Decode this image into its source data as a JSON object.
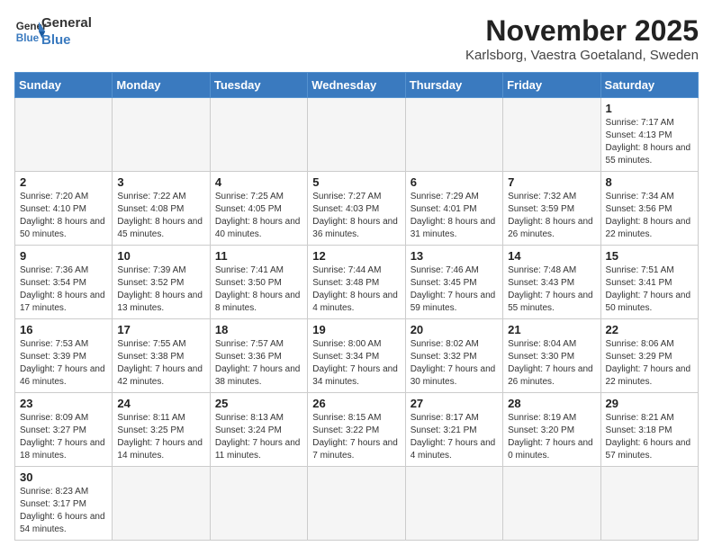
{
  "header": {
    "logo_line1": "General",
    "logo_line2": "Blue",
    "month": "November 2025",
    "location": "Karlsborg, Vaestra Goetaland, Sweden"
  },
  "days_of_week": [
    "Sunday",
    "Monday",
    "Tuesday",
    "Wednesday",
    "Thursday",
    "Friday",
    "Saturday"
  ],
  "weeks": [
    [
      {
        "day": "",
        "info": ""
      },
      {
        "day": "",
        "info": ""
      },
      {
        "day": "",
        "info": ""
      },
      {
        "day": "",
        "info": ""
      },
      {
        "day": "",
        "info": ""
      },
      {
        "day": "",
        "info": ""
      },
      {
        "day": "1",
        "info": "Sunrise: 7:17 AM\nSunset: 4:13 PM\nDaylight: 8 hours\nand 55 minutes."
      }
    ],
    [
      {
        "day": "2",
        "info": "Sunrise: 7:20 AM\nSunset: 4:10 PM\nDaylight: 8 hours\nand 50 minutes."
      },
      {
        "day": "3",
        "info": "Sunrise: 7:22 AM\nSunset: 4:08 PM\nDaylight: 8 hours\nand 45 minutes."
      },
      {
        "day": "4",
        "info": "Sunrise: 7:25 AM\nSunset: 4:05 PM\nDaylight: 8 hours\nand 40 minutes."
      },
      {
        "day": "5",
        "info": "Sunrise: 7:27 AM\nSunset: 4:03 PM\nDaylight: 8 hours\nand 36 minutes."
      },
      {
        "day": "6",
        "info": "Sunrise: 7:29 AM\nSunset: 4:01 PM\nDaylight: 8 hours\nand 31 minutes."
      },
      {
        "day": "7",
        "info": "Sunrise: 7:32 AM\nSunset: 3:59 PM\nDaylight: 8 hours\nand 26 minutes."
      },
      {
        "day": "8",
        "info": "Sunrise: 7:34 AM\nSunset: 3:56 PM\nDaylight: 8 hours\nand 22 minutes."
      }
    ],
    [
      {
        "day": "9",
        "info": "Sunrise: 7:36 AM\nSunset: 3:54 PM\nDaylight: 8 hours\nand 17 minutes."
      },
      {
        "day": "10",
        "info": "Sunrise: 7:39 AM\nSunset: 3:52 PM\nDaylight: 8 hours\nand 13 minutes."
      },
      {
        "day": "11",
        "info": "Sunrise: 7:41 AM\nSunset: 3:50 PM\nDaylight: 8 hours\nand 8 minutes."
      },
      {
        "day": "12",
        "info": "Sunrise: 7:44 AM\nSunset: 3:48 PM\nDaylight: 8 hours\nand 4 minutes."
      },
      {
        "day": "13",
        "info": "Sunrise: 7:46 AM\nSunset: 3:45 PM\nDaylight: 7 hours\nand 59 minutes."
      },
      {
        "day": "14",
        "info": "Sunrise: 7:48 AM\nSunset: 3:43 PM\nDaylight: 7 hours\nand 55 minutes."
      },
      {
        "day": "15",
        "info": "Sunrise: 7:51 AM\nSunset: 3:41 PM\nDaylight: 7 hours\nand 50 minutes."
      }
    ],
    [
      {
        "day": "16",
        "info": "Sunrise: 7:53 AM\nSunset: 3:39 PM\nDaylight: 7 hours\nand 46 minutes."
      },
      {
        "day": "17",
        "info": "Sunrise: 7:55 AM\nSunset: 3:38 PM\nDaylight: 7 hours\nand 42 minutes."
      },
      {
        "day": "18",
        "info": "Sunrise: 7:57 AM\nSunset: 3:36 PM\nDaylight: 7 hours\nand 38 minutes."
      },
      {
        "day": "19",
        "info": "Sunrise: 8:00 AM\nSunset: 3:34 PM\nDaylight: 7 hours\nand 34 minutes."
      },
      {
        "day": "20",
        "info": "Sunrise: 8:02 AM\nSunset: 3:32 PM\nDaylight: 7 hours\nand 30 minutes."
      },
      {
        "day": "21",
        "info": "Sunrise: 8:04 AM\nSunset: 3:30 PM\nDaylight: 7 hours\nand 26 minutes."
      },
      {
        "day": "22",
        "info": "Sunrise: 8:06 AM\nSunset: 3:29 PM\nDaylight: 7 hours\nand 22 minutes."
      }
    ],
    [
      {
        "day": "23",
        "info": "Sunrise: 8:09 AM\nSunset: 3:27 PM\nDaylight: 7 hours\nand 18 minutes."
      },
      {
        "day": "24",
        "info": "Sunrise: 8:11 AM\nSunset: 3:25 PM\nDaylight: 7 hours\nand 14 minutes."
      },
      {
        "day": "25",
        "info": "Sunrise: 8:13 AM\nSunset: 3:24 PM\nDaylight: 7 hours\nand 11 minutes."
      },
      {
        "day": "26",
        "info": "Sunrise: 8:15 AM\nSunset: 3:22 PM\nDaylight: 7 hours\nand 7 minutes."
      },
      {
        "day": "27",
        "info": "Sunrise: 8:17 AM\nSunset: 3:21 PM\nDaylight: 7 hours\nand 4 minutes."
      },
      {
        "day": "28",
        "info": "Sunrise: 8:19 AM\nSunset: 3:20 PM\nDaylight: 7 hours\nand 0 minutes."
      },
      {
        "day": "29",
        "info": "Sunrise: 8:21 AM\nSunset: 3:18 PM\nDaylight: 6 hours\nand 57 minutes."
      }
    ],
    [
      {
        "day": "30",
        "info": "Sunrise: 8:23 AM\nSunset: 3:17 PM\nDaylight: 6 hours\nand 54 minutes."
      },
      {
        "day": "",
        "info": ""
      },
      {
        "day": "",
        "info": ""
      },
      {
        "day": "",
        "info": ""
      },
      {
        "day": "",
        "info": ""
      },
      {
        "day": "",
        "info": ""
      },
      {
        "day": "",
        "info": ""
      }
    ]
  ]
}
